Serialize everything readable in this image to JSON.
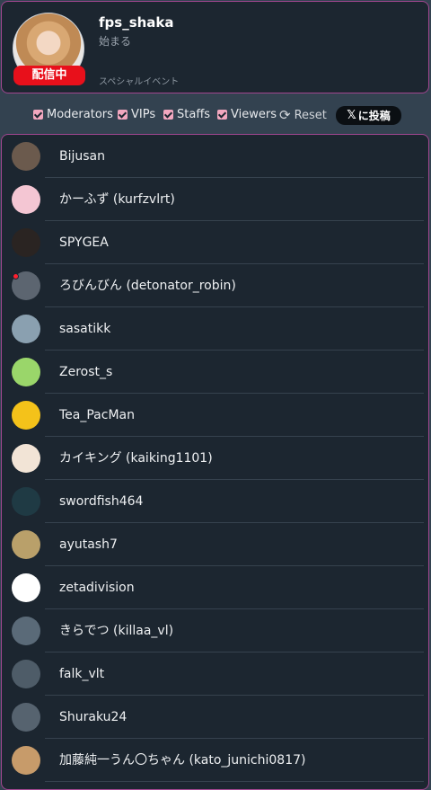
{
  "header": {
    "channel_name": "fps_shaka",
    "stream_title": "始まる",
    "category": "スペシャルイベント",
    "live_badge": "配信中"
  },
  "filters": [
    {
      "label": "Moderators",
      "checked": true
    },
    {
      "label": "VIPs",
      "checked": true
    },
    {
      "label": "Staffs",
      "checked": true
    },
    {
      "label": "Viewers",
      "checked": true
    }
  ],
  "reset_label": "Reset",
  "post_label": "に投稿",
  "post_x_glyph": "𝕏",
  "colors": {
    "accent_border": "#a0468f",
    "live_red": "#e8101b",
    "card_bg": "#1c2630",
    "page_bg": "#334250",
    "checkbox": "#f2a7bf"
  },
  "users": [
    {
      "name": "Bijusan",
      "avatar_color": "#6b5a4d",
      "live": false
    },
    {
      "name": "かーふず (kurfzvlrt)",
      "avatar_color": "#f4c6d3",
      "live": false
    },
    {
      "name": "SPYGEA",
      "avatar_color": "#2a2422",
      "live": false
    },
    {
      "name": "ろびんびん (detonator_robin)",
      "avatar_color": "#5c6570",
      "live": true
    },
    {
      "name": "sasatikk",
      "avatar_color": "#8aa0b0",
      "live": false
    },
    {
      "name": "Zerost_s",
      "avatar_color": "#9ad66a",
      "live": false
    },
    {
      "name": "Tea_PacMan",
      "avatar_color": "#f4c21a",
      "live": false
    },
    {
      "name": "カイキング (kaiking1101)",
      "avatar_color": "#f2e4d6",
      "live": false
    },
    {
      "name": "swordfish464",
      "avatar_color": "#1f3a44",
      "live": false
    },
    {
      "name": "ayutash7",
      "avatar_color": "#b9a06a",
      "live": false
    },
    {
      "name": "zetadivision",
      "avatar_color": "#ffffff",
      "live": false
    },
    {
      "name": "きらでつ (killaa_vl)",
      "avatar_color": "#5a6a78",
      "live": false
    },
    {
      "name": "falk_vlt",
      "avatar_color": "#4e5c68",
      "live": false
    },
    {
      "name": "Shuraku24",
      "avatar_color": "#56636f",
      "live": false
    },
    {
      "name": "加藤純一うん〇ちゃん (kato_junichi0817)",
      "avatar_color": "#c79b6a",
      "live": false
    }
  ]
}
